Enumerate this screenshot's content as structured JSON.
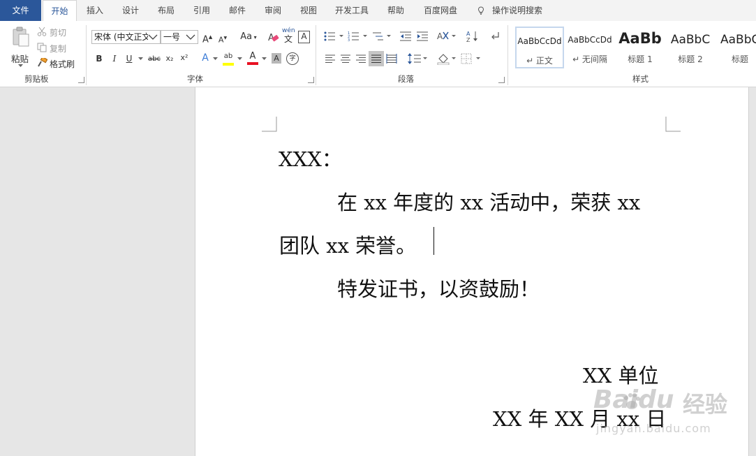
{
  "tabs": {
    "file": "文件",
    "home": "开始",
    "insert": "插入",
    "design": "设计",
    "layout": "布局",
    "references": "引用",
    "mailings": "邮件",
    "review": "审阅",
    "view": "视图",
    "developer": "开发工具",
    "help": "帮助",
    "baidu": "百度网盘",
    "tellme": "操作说明搜索"
  },
  "clipboard": {
    "paste": "粘贴",
    "cut": "剪切",
    "copy": "复制",
    "format_painter": "格式刷",
    "label": "剪贴板"
  },
  "font": {
    "name": "宋体 (中文正文",
    "size": "一号",
    "case_label": "Aa",
    "phonetic_top": "wén",
    "phonetic_bottom": "文",
    "border_char": "A",
    "bold": "B",
    "italic": "I",
    "underline": "U",
    "strike": "abc",
    "sub": "x₂",
    "sup": "x²",
    "effects": "A",
    "highlight": "ab",
    "color": "A",
    "shade": "A",
    "enclose": "字",
    "grow": "A",
    "shrink": "A",
    "label": "字体",
    "highlight_color": "#ffff00",
    "font_color": "#e81123"
  },
  "paragraph": {
    "label": "段落"
  },
  "styles": {
    "label": "样式",
    "items": [
      {
        "sample": "AaBbCcDd",
        "name": "↵ 正文"
      },
      {
        "sample": "AaBbCcDd",
        "name": "↵ 无间隔"
      },
      {
        "sample": "AaBb",
        "name": "标题 1"
      },
      {
        "sample": "AaBbC",
        "name": "标题 2"
      },
      {
        "sample": "AaBbC",
        "name": "标题"
      }
    ]
  },
  "document": {
    "salutation": "XXX：",
    "line1": "在 xx 年度的 xx 活动中，荣获 xx",
    "line2": "团队 xx 荣誉。",
    "line3": "特发证书，以资鼓励！",
    "signature_unit": "XX 单位",
    "signature_date": "XX 年 XX 月 xx 日"
  },
  "watermark": {
    "brand": "Baidu",
    "cn": "经验",
    "url": "jingyan.baidu.com"
  },
  "colors": {
    "accent": "#2b579a",
    "tab_bg": "#f3f3f3",
    "doc_bg": "#e6e6e6"
  }
}
